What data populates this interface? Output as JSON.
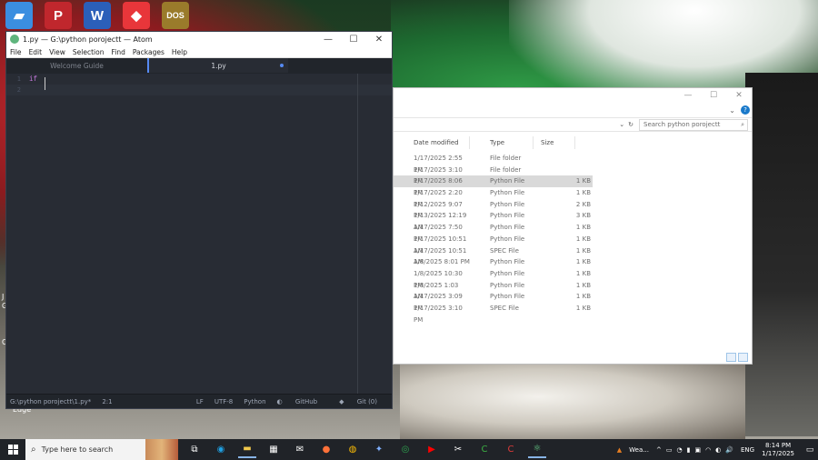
{
  "desktop": {
    "icons": [
      {
        "name": "this-pc-icon",
        "glyph": "▰",
        "color": "#3b8ee0"
      },
      {
        "name": "psiphon-icon",
        "glyph": "P",
        "color": "#c0272d"
      },
      {
        "name": "word-icon",
        "glyph": "W",
        "color": "#2b5fb9"
      },
      {
        "name": "anydesk-icon",
        "glyph": "◆",
        "color": "#e8363a"
      },
      {
        "name": "dosbox-icon",
        "glyph": "DOS",
        "color": "#9a7b2b"
      }
    ],
    "edge_label": "Edge",
    "side_letters": [
      "J",
      "G",
      "C"
    ]
  },
  "atom": {
    "title": "1.py — G:\\python porojectt — Atom",
    "controls": {
      "minimize": "—",
      "maximize": "☐",
      "close": "✕"
    },
    "menu": [
      "File",
      "Edit",
      "View",
      "Selection",
      "Find",
      "Packages",
      "Help"
    ],
    "tabs": [
      {
        "label": "Welcome Guide",
        "active": false
      },
      {
        "label": "1.py",
        "active": true,
        "modified": true
      }
    ],
    "lines": [
      "1",
      "2"
    ],
    "code": [
      "if",
      ""
    ],
    "status": {
      "path": "G:\\python porojectt\\1.py*",
      "cursor": "2:1",
      "line_ending": "LF",
      "encoding": "UTF-8",
      "grammar": "Python",
      "github": "GitHub",
      "git": "Git (0)"
    }
  },
  "explorer": {
    "controls": {
      "minimize": "—",
      "maximize": "☐",
      "close": "✕"
    },
    "expand": "⌄",
    "help": "?",
    "search_placeholder": "Search python porojectt",
    "columns": {
      "date": "Date modified",
      "type": "Type",
      "size": "Size"
    },
    "rows": [
      {
        "date": "1/17/2025 2:55 PM",
        "type": "File folder",
        "size": ""
      },
      {
        "date": "1/17/2025 3:10 PM",
        "type": "File folder",
        "size": ""
      },
      {
        "date": "1/17/2025 8:06 PM",
        "type": "Python File",
        "size": "1 KB",
        "selected": true
      },
      {
        "date": "1/17/2025 2:20 PM",
        "type": "Python File",
        "size": "1 KB"
      },
      {
        "date": "1/12/2025 9:07 PM",
        "type": "Python File",
        "size": "2 KB"
      },
      {
        "date": "1/13/2025 12:19 AM",
        "type": "Python File",
        "size": "3 KB"
      },
      {
        "date": "1/17/2025 7:50 PM",
        "type": "Python File",
        "size": "1 KB"
      },
      {
        "date": "1/17/2025 10:51 AM",
        "type": "Python File",
        "size": "1 KB"
      },
      {
        "date": "1/17/2025 10:51 AM",
        "type": "SPEC File",
        "size": "1 KB"
      },
      {
        "date": "1/8/2025 8:01 PM",
        "type": "Python File",
        "size": "1 KB"
      },
      {
        "date": "1/8/2025 10:30 PM",
        "type": "Python File",
        "size": "1 KB"
      },
      {
        "date": "1/8/2025 1:03 AM",
        "type": "Python File",
        "size": "1 KB"
      },
      {
        "date": "1/17/2025 3:09 PM",
        "type": "Python File",
        "size": "1 KB"
      },
      {
        "date": "1/17/2025 3:10 PM",
        "type": "SPEC File",
        "size": "1 KB"
      }
    ]
  },
  "taskbar": {
    "search_placeholder": "Type here to search",
    "apps": [
      {
        "name": "task-view-icon",
        "glyph": "⧉",
        "color": "#ffffff"
      },
      {
        "name": "edge-icon",
        "glyph": "◉",
        "color": "#1fa0e3"
      },
      {
        "name": "file-explorer-icon",
        "glyph": "▬",
        "color": "#f2c94c",
        "active": true
      },
      {
        "name": "store-icon",
        "glyph": "▦",
        "color": "#ffffff"
      },
      {
        "name": "mail-icon",
        "glyph": "✉",
        "color": "#ffffff"
      },
      {
        "name": "firefox-icon",
        "glyph": "●",
        "color": "#ff7139"
      },
      {
        "name": "chrome-icon",
        "glyph": "◍",
        "color": "#fbbc05"
      },
      {
        "name": "copilot-icon",
        "glyph": "✦",
        "color": "#7fb0ff"
      },
      {
        "name": "app-icon",
        "glyph": "◎",
        "color": "#2ea44f"
      },
      {
        "name": "youtube-icon",
        "glyph": "▶",
        "color": "#ff0000"
      },
      {
        "name": "capcut-icon",
        "glyph": "✂",
        "color": "#ffffff"
      },
      {
        "name": "green-app-icon",
        "glyph": "C",
        "color": "#3cb043"
      },
      {
        "name": "red-app-icon",
        "glyph": "C",
        "color": "#e03a3a"
      },
      {
        "name": "atom-icon",
        "glyph": "⚛",
        "color": "#66cc88",
        "active": true
      }
    ],
    "weather": "Wea...",
    "tray_icons": [
      "^",
      "▭",
      "◔",
      "▮",
      "▣",
      "◠",
      "◐",
      "🔊"
    ],
    "language": "ENG",
    "time": "8:14 PM",
    "date": "1/17/2025",
    "notification": "▭"
  }
}
